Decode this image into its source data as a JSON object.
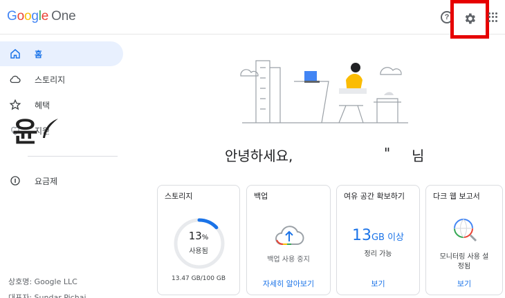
{
  "header": {
    "logo_parts": [
      "G",
      "o",
      "o",
      "g",
      "l",
      "e"
    ],
    "logo_suffix": "One",
    "help_label": "?"
  },
  "sidebar": {
    "items": [
      {
        "label": "홈",
        "icon": "home-icon",
        "active": true
      },
      {
        "label": "스토리지",
        "icon": "cloud-icon",
        "active": false
      },
      {
        "label": "혜택",
        "icon": "star-icon",
        "active": false
      },
      {
        "label": "지원",
        "icon": "support-icon",
        "active": false
      },
      {
        "label": "요금제",
        "icon": "plan-icon",
        "active": false
      }
    ],
    "watermark": "윤",
    "footer": {
      "company": "상호명: Google LLC",
      "ceo": "대표자: Sundar Pichai"
    }
  },
  "main": {
    "greeting": "안녕하세요,",
    "greeting_quote": "\"",
    "greeting_suffix": "님",
    "cards": [
      {
        "title": "스토리지",
        "percent": "13",
        "percent_unit": "%",
        "used_label": "사용됨",
        "usage": "13.47 GB/100 GB",
        "fraction_used": 0.13
      },
      {
        "title": "백업",
        "status": "백업 사용 중지",
        "link": "자세히 알아보기"
      },
      {
        "title": "여유 공간 확보하기",
        "amount": "13",
        "amount_unit": "GB 이상",
        "sub": "정리 가능",
        "link": "보기"
      },
      {
        "title": "다크 웹 보고서",
        "text_line1": "모니터링 사용 설",
        "text_line2": "정됨",
        "link": "보기"
      }
    ]
  },
  "colors": {
    "accent": "#1a73e8",
    "active_bg": "#e8f0fe",
    "highlight_box": "#e60000"
  }
}
